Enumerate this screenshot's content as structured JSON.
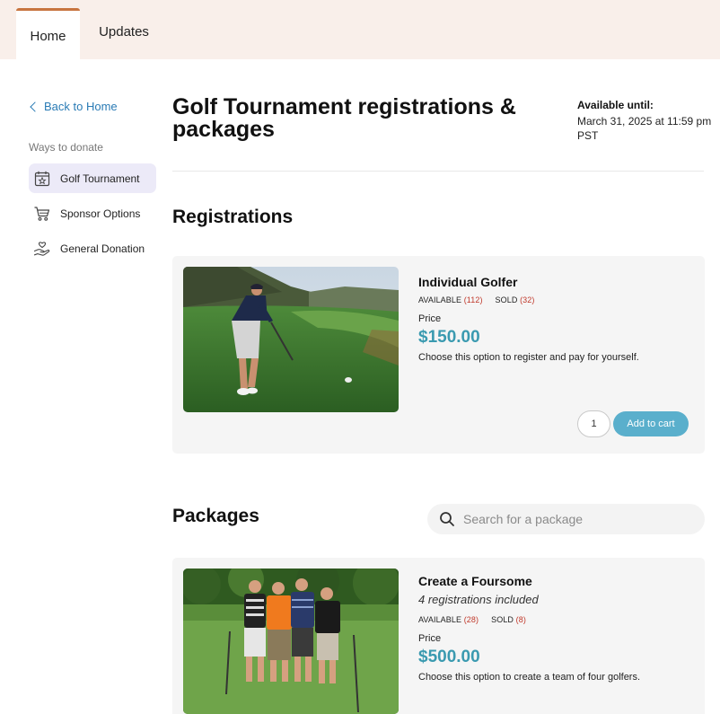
{
  "tabs": {
    "home": "Home",
    "updates": "Updates"
  },
  "sidebar": {
    "back_label": "Back to Home",
    "caption": "Ways to donate",
    "items": [
      {
        "label": "Golf Tournament",
        "icon": "calendar-star-icon"
      },
      {
        "label": "Sponsor Options",
        "icon": "shopping-cart-icon"
      },
      {
        "label": "General Donation",
        "icon": "hand-heart-icon"
      }
    ]
  },
  "page": {
    "title": "Golf Tournament registrations & packages",
    "available_title": "Available until:",
    "available_date": "March 31, 2025 at 11:59 pm PST"
  },
  "registrations": {
    "title": "Registrations",
    "items": [
      {
        "name": "Individual Golfer",
        "available_label": "AVAILABLE",
        "available_count": "(112)",
        "sold_label": "SOLD",
        "sold_count": "(32)",
        "price_label": "Price",
        "price": "$150.00",
        "description": "Choose this option to register and pay for yourself.",
        "quantity": "1",
        "add_label": "Add to cart"
      }
    ]
  },
  "packages": {
    "title": "Packages",
    "search_placeholder": "Search for a package",
    "items": [
      {
        "name": "Create a Foursome",
        "subtitle": "4 registrations included",
        "available_label": "AVAILABLE",
        "available_count": "(28)",
        "sold_label": "SOLD",
        "sold_count": "(8)",
        "price_label": "Price",
        "price": "$500.00",
        "description": "Choose this option to create a team of four golfers."
      }
    ]
  },
  "colors": {
    "accent": "#c8743f",
    "link": "#2a7bb5",
    "price": "#3a9ab0",
    "button": "#5aafcc",
    "count": "#c0392b"
  }
}
